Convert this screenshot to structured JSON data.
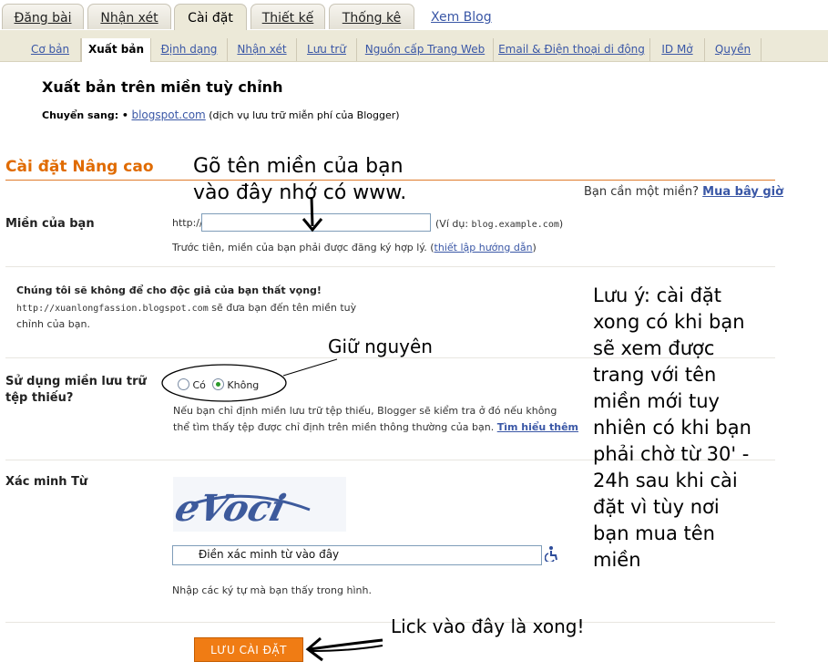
{
  "tabs": [
    {
      "label": "Đăng bài",
      "active": false
    },
    {
      "label": "Nhận xét",
      "active": false
    },
    {
      "label": "Cài đặt",
      "active": true
    },
    {
      "label": "Thiết kế",
      "active": false
    },
    {
      "label": "Thống kê",
      "active": false
    }
  ],
  "view_blog": "Xem Blog",
  "subtabs": [
    {
      "label": "Cơ bản"
    },
    {
      "label": "Xuất bản",
      "active": true
    },
    {
      "label": "Định dạng"
    },
    {
      "label": "Nhận xét"
    },
    {
      "label": "Lưu trữ"
    },
    {
      "label": "Nguồn cấp Trang Web"
    },
    {
      "label": "Email & Điện thoại di động"
    },
    {
      "label": "ID Mở"
    },
    {
      "label": "Quyền"
    }
  ],
  "publish": {
    "title": "Xuất bản trên miền tuỳ chỉnh",
    "switch_label": "Chuyển sang: •",
    "switch_link": "blogspot.com",
    "switch_note": "(dịch vụ lưu trữ miễn phí của Blogger)"
  },
  "advanced": {
    "title": "Cài đặt Nâng cao",
    "need_domain": "Bạn cần một miền?",
    "buy_link": "Mua bây giờ"
  },
  "domain": {
    "label": "Miền của bạn",
    "prefix": "http://",
    "value": "",
    "example_prefix": "(Ví dụ:",
    "example": "blog.example.com",
    "example_suffix": ")",
    "note": "Trước tiên, miền của bạn phải được đăng ký hợp lý. (",
    "note_link": "thiết lập hướng dẫn",
    "note_end": ")"
  },
  "promise": {
    "title": "Chúng tôi sẽ không để cho độc giả của bạn thất vọng!",
    "url": "http://xuanlongfassion.blogspot.com",
    "text1": "sẽ đưa bạn đến tên miền tuỳ",
    "text2": "chỉnh của bạn."
  },
  "missing_files": {
    "label_line1": "Sử dụng miền lưu trữ",
    "label_line2": "tệp thiếu?",
    "option_yes": "Có",
    "option_no": "Không",
    "selected": "Không",
    "help1": "Nếu bạn chỉ định miền lưu trữ tệp thiếu, Blogger sẽ kiểm tra ở đó nếu không",
    "help2": "thể tìm thấy tệp được chỉ định trên miền thông thường của bạn.",
    "help_link": "Tìm hiểu thêm"
  },
  "verify": {
    "label": "Xác minh Từ",
    "captcha_text": "eVoci",
    "input_value": "Điền xác minh từ vào đây",
    "hint": "Nhập các ký tự mà bạn thấy trong hình."
  },
  "save_button": "LƯU CÀI ĐẶT",
  "annotations": {
    "enter_domain_line1": "Gõ tên miền của bạn",
    "enter_domain_line2": "vào đây nhớ có www.",
    "keep": "Giữ nguyên",
    "note_lines": [
      "Lưu ý: cài đặt",
      "xong có khi bạn",
      "sẽ xem được",
      "trang với tên",
      "miền mới tuy",
      "nhiên có khi bạn",
      "phải chờ từ 30' -",
      "24h sau khi cài",
      "đặt vì tùy nơi",
      "bạn mua tên",
      "miền"
    ],
    "click_here": "Lick vào đây là xong!"
  },
  "colors": {
    "accent": "#e06b00",
    "link": "#3a57a6",
    "button": "#f07c14",
    "tabbar": "#ece9d8"
  }
}
